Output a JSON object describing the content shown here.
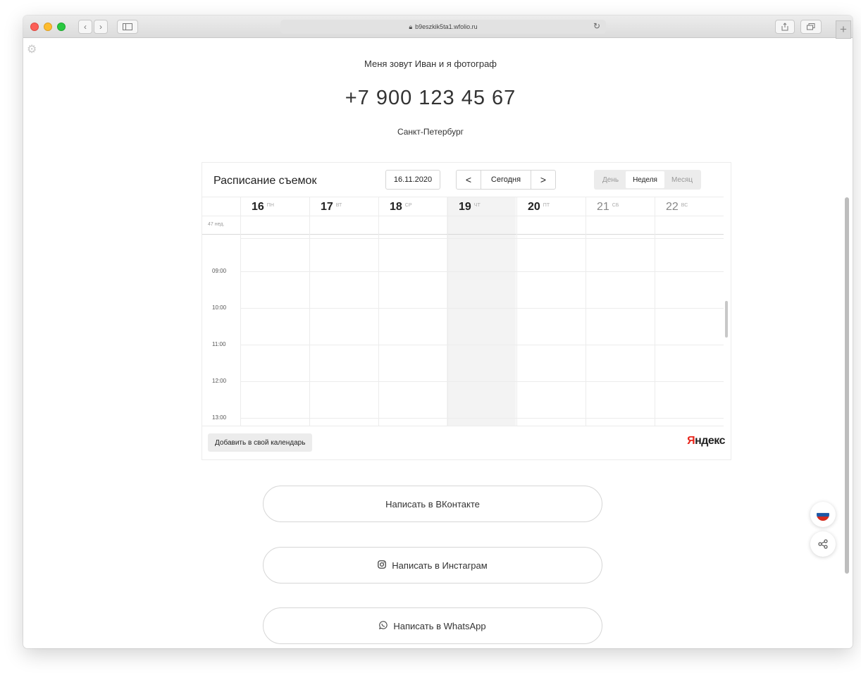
{
  "browser": {
    "url": "b9eszkik5ta1.wfolio.ru",
    "new_tab": "+"
  },
  "profile": {
    "intro": "Меня зовут Иван и я фотограф",
    "phone": "+7 900 123 45 67",
    "city": "Санкт-Петербург"
  },
  "calendar": {
    "title": "Расписание съемок",
    "date": "16.11.2020",
    "nav_prev": "<",
    "nav_today": "Сегодня",
    "nav_next": ">",
    "views": [
      "День",
      "Неделя",
      "Месяц"
    ],
    "active_view": "Неделя",
    "week_label": "47 нед.",
    "days": [
      {
        "num": "16",
        "dow": "ПН"
      },
      {
        "num": "17",
        "dow": "ВТ"
      },
      {
        "num": "18",
        "dow": "СР"
      },
      {
        "num": "19",
        "dow": "ЧТ"
      },
      {
        "num": "20",
        "dow": "ПТ"
      },
      {
        "num": "21",
        "dow": "СБ"
      },
      {
        "num": "22",
        "dow": "ВС"
      }
    ],
    "hours": [
      "09:00",
      "10:00",
      "11:00",
      "12:00",
      "13:00"
    ],
    "add_button": "Добавить в свой календарь",
    "brand_first": "Я",
    "brand_rest": "ндекс"
  },
  "actions": {
    "vk": "Написать в ВКонтакте",
    "instagram": "Написать в Инстаграм",
    "whatsapp": "Написать в WhatsApp"
  },
  "colors": {
    "flag": [
      "#ffffff",
      "#1c57a5",
      "#d52b1e"
    ],
    "yandex_red": "#e8261c",
    "today_column": "#f3f3f3"
  }
}
